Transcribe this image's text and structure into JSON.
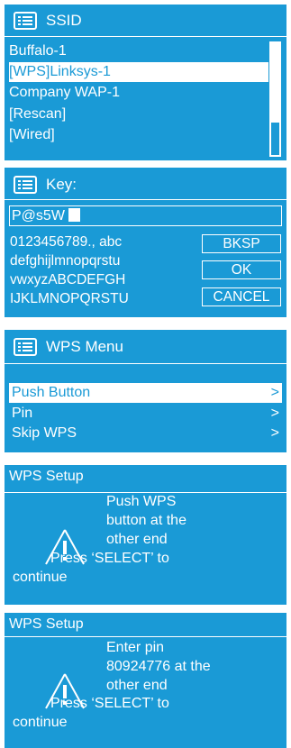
{
  "ssid_screen": {
    "title": "SSID",
    "networks": [
      "Buffalo-1",
      "[WPS]Linksys-1",
      "Company WAP-1",
      "[Rescan]",
      "[Wired]"
    ],
    "selected_index": 1
  },
  "key_screen": {
    "title": "Key:",
    "input_value": "P@s5W",
    "char_lines": [
      "0123456789., abc",
      "defghijlmnopqrstu",
      "vwxyzABCDEFGH",
      "IJKLMNOPQRSTU"
    ],
    "buttons": [
      "BKSP",
      "OK",
      "CANCEL"
    ]
  },
  "wps_menu": {
    "title": "WPS Menu",
    "items": [
      {
        "label": "Push Button",
        "arrow": ">"
      },
      {
        "label": "Pin",
        "arrow": ">"
      },
      {
        "label": "Skip WPS",
        "arrow": ">"
      }
    ],
    "selected_index": 0
  },
  "wps_setup_push": {
    "title": "WPS Setup",
    "lines": [
      "Push WPS",
      "button at the",
      "other end",
      "Press ‘SELECT’ to",
      "continue"
    ]
  },
  "wps_setup_pin": {
    "title": "WPS Setup",
    "lines": [
      "Enter pin",
      "80924776 at the",
      "other end",
      "Press ‘SELECT’ to",
      "continue"
    ]
  },
  "colors": {
    "screen_blue": "#1a9ad6",
    "text": "#ffffff"
  },
  "icons": [
    "menu-list-icon",
    "warning-icon"
  ]
}
